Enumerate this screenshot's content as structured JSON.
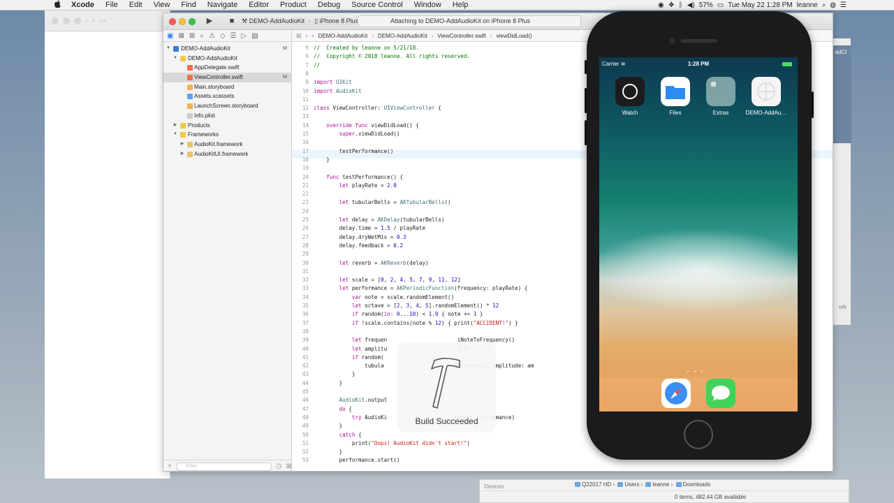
{
  "menubar": {
    "apple": "",
    "items": [
      "Xcode",
      "File",
      "Edit",
      "View",
      "Find",
      "Navigate",
      "Editor",
      "Product",
      "Debug",
      "Source Control",
      "Window",
      "Help"
    ],
    "battery": "57%",
    "clock": "Tue May 22  1:28 PM",
    "user": "leanne"
  },
  "toolbar": {
    "run_icon": "▶",
    "stop_icon": "■",
    "scheme_target": "DEMO-AddAudioKit",
    "scheme_device": "iPhone 8 Plus",
    "activity": "Attaching to DEMO-AddAudioKit on iPhone 8 Plus"
  },
  "navigator": {
    "badge_m": "M",
    "items": [
      {
        "label": "DEMO-AddAudioKit",
        "badge": "M"
      },
      {
        "label": "DEMO-AddAudioKit",
        "badge": ""
      },
      {
        "label": "AppDelegate.swift",
        "badge": ""
      },
      {
        "label": "ViewController.swift",
        "badge": "M"
      },
      {
        "label": "Main.storyboard",
        "badge": ""
      },
      {
        "label": "Assets.xcassets",
        "badge": ""
      },
      {
        "label": "LaunchScreen.storyboard",
        "badge": ""
      },
      {
        "label": "Info.plist",
        "badge": ""
      },
      {
        "label": "Products",
        "badge": ""
      },
      {
        "label": "Frameworks",
        "badge": ""
      },
      {
        "label": "AudioKit.framework",
        "badge": ""
      },
      {
        "label": "AudioKitUI.framework",
        "badge": ""
      }
    ],
    "filter_placeholder": "Filter"
  },
  "jumpbar": {
    "crumbs": [
      "DEMO-AddAudioKit",
      "DEMO-AddAudioKit",
      "ViewController.swift",
      "viewDidLoad()"
    ]
  },
  "editor": {
    "lines": [
      {
        "n": "5",
        "t": "//  Created by leanne on 5/21/18."
      },
      {
        "n": "6",
        "t": "//  Copyright © 2018 leanne. All rights reserved."
      },
      {
        "n": "7",
        "t": "//"
      },
      {
        "n": "8",
        "t": ""
      },
      {
        "n": "9",
        "t": "import UIKit"
      },
      {
        "n": "10",
        "t": "import AudioKit"
      },
      {
        "n": "11",
        "t": ""
      },
      {
        "n": "12",
        "t": "class ViewController: UIViewController {"
      },
      {
        "n": "13",
        "t": ""
      },
      {
        "n": "14",
        "t": "    override func viewDidLoad() {"
      },
      {
        "n": "15",
        "t": "        super.viewDidLoad()"
      },
      {
        "n": "16",
        "t": ""
      },
      {
        "n": "17",
        "t": "        testPerformance()"
      },
      {
        "n": "18",
        "t": "    }"
      },
      {
        "n": "19",
        "t": ""
      },
      {
        "n": "20",
        "t": "    func testPerformance() {"
      },
      {
        "n": "21",
        "t": "        let playRate = 2.0"
      },
      {
        "n": "22",
        "t": ""
      },
      {
        "n": "23",
        "t": "        let tubularBells = AKTubularBells()"
      },
      {
        "n": "24",
        "t": ""
      },
      {
        "n": "25",
        "t": "        let delay = AKDelay(tubularBells)"
      },
      {
        "n": "26",
        "t": "        delay.time = 1.5 / playRate"
      },
      {
        "n": "27",
        "t": "        delay.dryWetMix = 0.3"
      },
      {
        "n": "28",
        "t": "        delay.feedback = 0.2"
      },
      {
        "n": "29",
        "t": ""
      },
      {
        "n": "30",
        "t": "        let reverb = AKReverb(delay)"
      },
      {
        "n": "31",
        "t": ""
      },
      {
        "n": "32",
        "t": "        let scale = [0, 2, 4, 5, 7, 9, 11, 12]"
      },
      {
        "n": "33",
        "t": "        let performance = AKPeriodicFunction(frequency: playRate) {"
      },
      {
        "n": "34",
        "t": "            var note = scale.randomElement()"
      },
      {
        "n": "35",
        "t": "            let octave = [2, 3, 4, 5].randomElement() * 12"
      },
      {
        "n": "36",
        "t": "            if random(in: 0...10) < 1.0 { note += 1 }"
      },
      {
        "n": "37",
        "t": "            if !scale.contains(note % 12) { print(\"ACCIDENT!\") }"
      },
      {
        "n": "38",
        "t": ""
      },
      {
        "n": "39",
        "t": "            let frequen                      iNoteToFrequency()"
      },
      {
        "n": "40",
        "t": "            let amplitu                      3.5)"
      },
      {
        "n": "41",
        "t": "            if random("
      },
      {
        "n": "42",
        "t": "                tubula                       frequency, amplitude: am"
      },
      {
        "n": "43",
        "t": "            }"
      },
      {
        "n": "44",
        "t": "        }"
      },
      {
        "n": "45",
        "t": ""
      },
      {
        "n": "46",
        "t": "        AudioKit.output"
      },
      {
        "n": "47",
        "t": "        do {"
      },
      {
        "n": "48",
        "t": "            try AudioKi                     tions: performance)"
      },
      {
        "n": "49",
        "t": "        }"
      },
      {
        "n": "50",
        "t": "        catch {"
      },
      {
        "n": "51",
        "t": "            print(\"Oops! AudioKit didn't start!\")"
      },
      {
        "n": "52",
        "t": "        }"
      },
      {
        "n": "53",
        "t": "        performance.start()"
      }
    ]
  },
  "hud": {
    "message": "Build Succeeded",
    "icon": "hammer-icon"
  },
  "simulator": {
    "carrier": "Carrier",
    "time": "1:28 PM",
    "apps": [
      {
        "label": "Watch",
        "color": "#1c1c1e"
      },
      {
        "label": "Files",
        "color": "#2d8cf0"
      },
      {
        "label": "Extras",
        "color": "#8fb3b3"
      },
      {
        "label": "DEMO-AddAu…",
        "color": "#f4f4f4"
      }
    ],
    "page_dots": "• • •",
    "dock": [
      {
        "name": "safari-icon",
        "color": "#3a8ef6"
      },
      {
        "name": "messages-icon",
        "color": "#41d25b"
      }
    ]
  },
  "bg_window": {
    "right_label_top": "adCl",
    "right_label_bottom": "ork"
  },
  "finder": {
    "devices": "Devices",
    "path": [
      "Q22017 HD",
      "Users",
      "leanne",
      "Downloads"
    ],
    "status": "0 items, 482.44 GB available"
  }
}
